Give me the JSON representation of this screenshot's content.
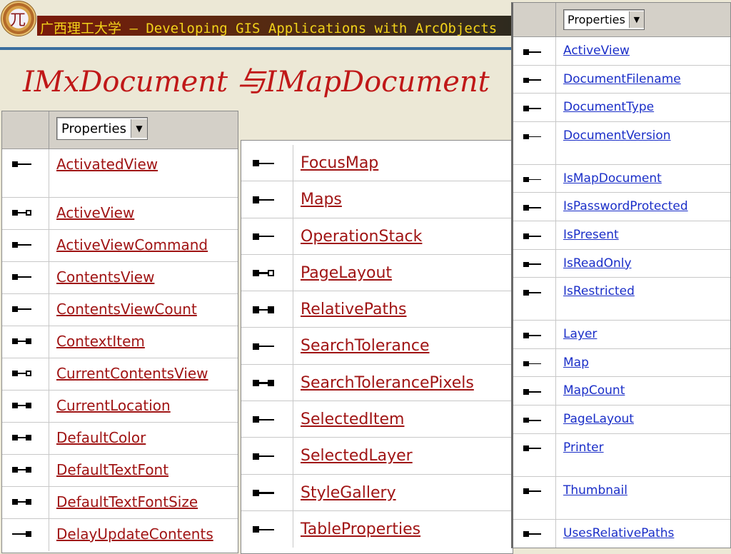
{
  "header": {
    "title_text": "广西理工大学 — Developing GIS Applications with ArcObjects",
    "logo_glyph": "兀"
  },
  "slide": {
    "title": "IMxDocument 与IMapDocument"
  },
  "colors": {
    "title_red": "#c01818",
    "link_red": "#a01414",
    "link_blue": "#1a2ec8",
    "header_yellow": "#f2d21a",
    "rule_blue": "#3a6e9e"
  },
  "icon_legend": {
    "read": "property-get-icon",
    "write": "property-put-icon",
    "readwrite": "property-get-put-icon",
    "read_byref": "property-put-ref-icon",
    "write_only": "property-write-only-icon"
  },
  "panel_left": {
    "dropdown_value": "Properties",
    "items": [
      {
        "name": "ActivatedView",
        "icon": "read"
      },
      {
        "name": "ActiveView",
        "icon": "read_byref"
      },
      {
        "name": "ActiveViewCommand",
        "icon": "read"
      },
      {
        "name": "ContentsView",
        "icon": "read"
      },
      {
        "name": "ContentsViewCount",
        "icon": "read"
      },
      {
        "name": "ContextItem",
        "icon": "readwrite"
      },
      {
        "name": "CurrentContentsView",
        "icon": "read_byref"
      },
      {
        "name": "CurrentLocation",
        "icon": "readwrite"
      },
      {
        "name": "DefaultColor",
        "icon": "readwrite"
      },
      {
        "name": "DefaultTextFont",
        "icon": "readwrite"
      },
      {
        "name": "DefaultTextFontSize",
        "icon": "readwrite"
      },
      {
        "name": "DelayUpdateContents",
        "icon": "write_only"
      }
    ]
  },
  "panel_middle": {
    "items": [
      {
        "name": "FocusMap",
        "icon": "read"
      },
      {
        "name": "Maps",
        "icon": "read"
      },
      {
        "name": "OperationStack",
        "icon": "read"
      },
      {
        "name": "PageLayout",
        "icon": "read_byref"
      },
      {
        "name": "RelativePaths",
        "icon": "readwrite"
      },
      {
        "name": "SearchTolerance",
        "icon": "read"
      },
      {
        "name": "SearchTolerancePixels",
        "icon": "readwrite"
      },
      {
        "name": "SelectedItem",
        "icon": "read"
      },
      {
        "name": "SelectedLayer",
        "icon": "read"
      },
      {
        "name": "StyleGallery",
        "icon": "read"
      },
      {
        "name": "TableProperties",
        "icon": "read"
      }
    ]
  },
  "panel_right": {
    "dropdown_value": "Properties",
    "items": [
      {
        "name": "ActiveView",
        "icon": "read"
      },
      {
        "name": "DocumentFilename",
        "icon": "read"
      },
      {
        "name": "DocumentType",
        "icon": "read"
      },
      {
        "name": "DocumentVersion",
        "icon": "read"
      },
      {
        "name": "IsMapDocument",
        "icon": "read"
      },
      {
        "name": "IsPasswordProtected",
        "icon": "read"
      },
      {
        "name": "IsPresent",
        "icon": "read"
      },
      {
        "name": "IsReadOnly",
        "icon": "read"
      },
      {
        "name": "IsRestricted",
        "icon": "read"
      },
      {
        "name": "Layer",
        "icon": "read"
      },
      {
        "name": "Map",
        "icon": "read"
      },
      {
        "name": "MapCount",
        "icon": "read"
      },
      {
        "name": "PageLayout",
        "icon": "read"
      },
      {
        "name": "Printer",
        "icon": "read"
      },
      {
        "name": "Thumbnail",
        "icon": "read"
      },
      {
        "name": "UsesRelativePaths",
        "icon": "read"
      }
    ]
  }
}
